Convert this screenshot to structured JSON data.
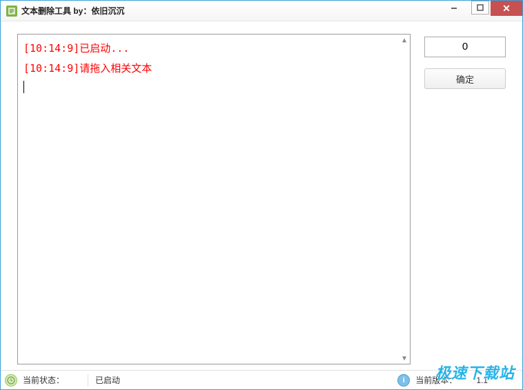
{
  "window": {
    "title": "文本删除工具 by：依旧沉沉"
  },
  "console": {
    "lines": [
      "[10:14:9]已启动...",
      "[10:14:9]请拖入相关文本"
    ]
  },
  "side": {
    "counter": "0",
    "ok_label": "确定"
  },
  "statusbar": {
    "state_label": "当前状态：",
    "state_value": "已启动",
    "version_label": "当前版本：",
    "version_value": "1.1"
  },
  "watermark": "极速下载站"
}
